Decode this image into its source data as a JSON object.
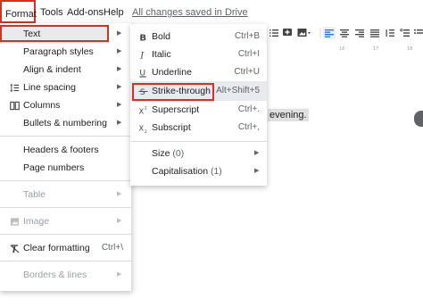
{
  "menubar": {
    "format": "Format",
    "tools": "Tools",
    "addons": "Add-ons",
    "help": "Help",
    "saved_status": "All changes saved in Drive"
  },
  "toolbar": {
    "icons": [
      "numbered-list-icon",
      "add-comment-icon",
      "insert-image-icon",
      "align-left-icon",
      "align-center-icon",
      "align-right-icon",
      "justify-icon"
    ]
  },
  "ruler": {
    "marks": [
      "16",
      "17",
      "18"
    ]
  },
  "document": {
    "visible_text": "evening."
  },
  "format_menu": {
    "items": [
      {
        "label": "Text",
        "has_submenu": true,
        "icon": "",
        "highlighted": true
      },
      {
        "label": "Paragraph styles",
        "has_submenu": true,
        "icon": ""
      },
      {
        "label": "Align & indent",
        "has_submenu": true,
        "icon": ""
      },
      {
        "label": "Line spacing",
        "has_submenu": true,
        "icon": "line-spacing-icon"
      },
      {
        "label": "Columns",
        "has_submenu": true,
        "icon": "columns-icon"
      },
      {
        "label": "Bullets & numbering",
        "has_submenu": true,
        "icon": ""
      },
      {
        "label": "Headers & footers",
        "has_submenu": false,
        "icon": ""
      },
      {
        "label": "Page numbers",
        "has_submenu": false,
        "icon": ""
      },
      {
        "label": "Table",
        "has_submenu": true,
        "icon": "",
        "disabled": true
      },
      {
        "label": "Image",
        "has_submenu": true,
        "icon": "image-icon",
        "disabled": true
      },
      {
        "label": "Clear formatting",
        "shortcut": "Ctrl+\\",
        "icon": "clear-formatting-icon"
      },
      {
        "label": "Borders & lines",
        "has_submenu": true,
        "icon": "",
        "disabled": true
      }
    ]
  },
  "text_submenu": {
    "items": [
      {
        "label": "Bold",
        "shortcut": "Ctrl+B",
        "icon": "bold-icon"
      },
      {
        "label": "Italic",
        "shortcut": "Ctrl+I",
        "icon": "italic-icon"
      },
      {
        "label": "Underline",
        "shortcut": "Ctrl+U",
        "icon": "underline-icon"
      },
      {
        "label": "Strike-through",
        "shortcut": "Alt+Shift+5",
        "icon": "strikethrough-icon",
        "highlighted": true
      },
      {
        "label": "Superscript",
        "shortcut": "Ctrl+.",
        "icon": "superscript-icon"
      },
      {
        "label": "Subscript",
        "shortcut": "Ctrl+,",
        "icon": "subscript-icon"
      },
      {
        "label": "Size",
        "count": "(0)",
        "has_submenu": true
      },
      {
        "label": "Capitalisation",
        "count": "(1)",
        "has_submenu": true
      }
    ]
  },
  "colors": {
    "highlight_border": "#d93025",
    "hover_background": "#e8eaed",
    "disabled_text": "#9aa0a6"
  }
}
